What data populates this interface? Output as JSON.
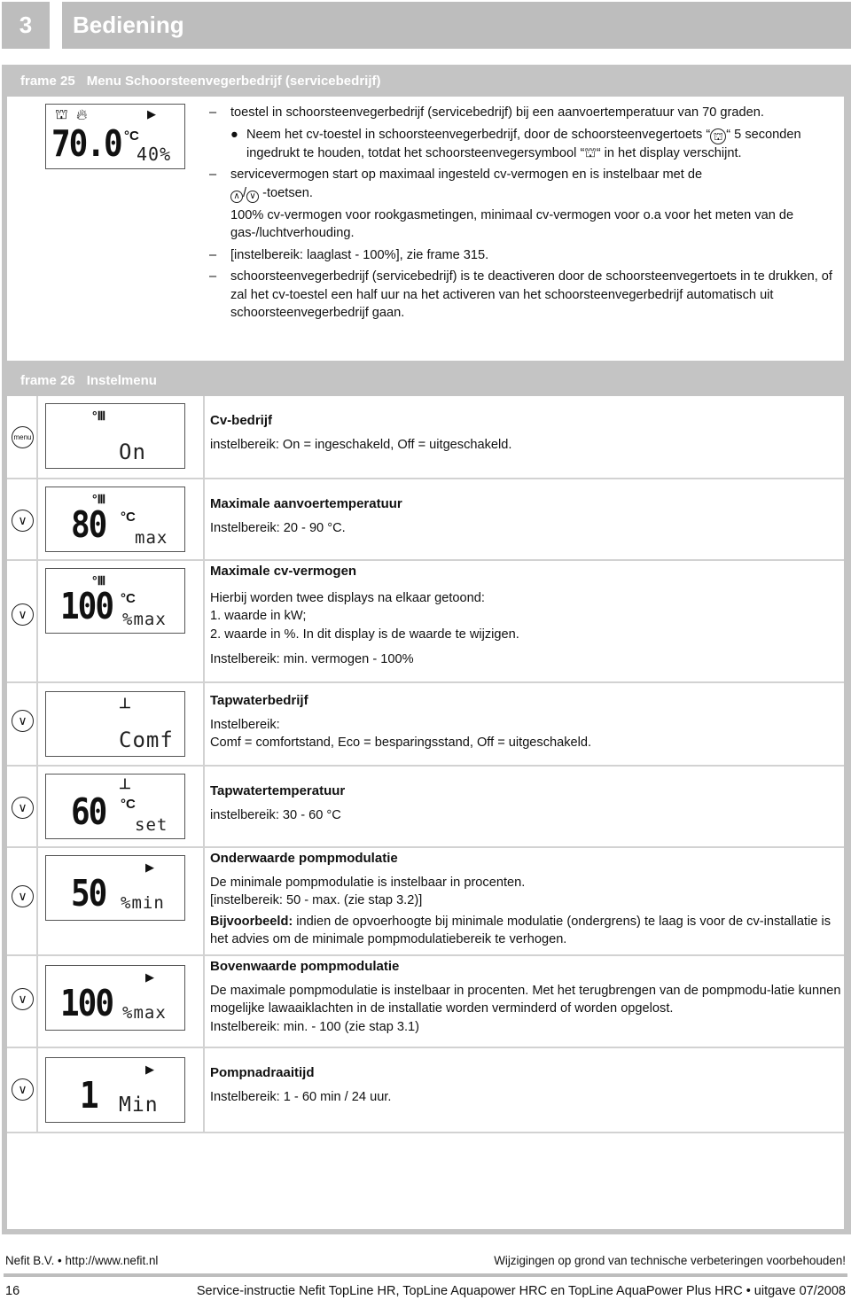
{
  "chapter": {
    "number": "3",
    "title": "Bediening"
  },
  "frame25": {
    "number": "frame 25",
    "title": "Menu Schoorsteenvegerbedrijf (servicebedrijf)",
    "display": {
      "main_value": "70.0",
      "unit": "°C",
      "secondary": "40%",
      "icons": [
        "chimney-sweep-icon",
        "flame-icon",
        "pump-icon"
      ]
    },
    "items": [
      {
        "dash": "–",
        "text": "toestel in schoorsteenvegerbedrijf (servicebedrijf) bij een aanvoertemperatuur van 70 graden."
      },
      {
        "bullet": "●",
        "text_a": "Neem het cv-toestel in schoorsteenvegerbedrijf, door de schoorsteenvegertoets “",
        "text_b": "“ 5 seconden ingedrukt te houden, totdat het schoorsteenvegersymbool “",
        "text_c": "“ in het display verschijnt."
      },
      {
        "dash": "–",
        "text_a": "servicevermogen start op maximaal ingesteld cv-vermogen en is instelbaar met de ",
        "up_key": "∧",
        "slash": "/",
        "down_key": "∨",
        "text_b": " -toetsen."
      },
      {
        "text": "100% cv-vermogen voor rookgasmetingen, minimaal cv-vermogen voor o.a voor het meten van de gas-/luchtverhouding."
      },
      {
        "dash": "–",
        "text": "[instelbereik: laaglast - 100%], zie frame 315."
      },
      {
        "dash": "–",
        "text": "schoorsteenvegerbedrijf (servicebedrijf) is te deactiveren door de schoorsteenvegertoets in te drukken, of zal het cv-toestel een half uur na het activeren van het schoorsteenvegerbedrijf automatisch uit schoorsteenvegerbedrijf gaan."
      }
    ]
  },
  "frame26": {
    "number": "frame 26",
    "title": "Instelmenu",
    "rows": [
      {
        "key": "menu",
        "display": {
          "icon": "radiator-icon",
          "main": "",
          "unit": "",
          "dot": "On"
        },
        "title": "Cv-bedrijf",
        "lines": [
          "instelbereik: On = ingeschakeld, Off = uitgeschakeld."
        ]
      },
      {
        "key": "∨",
        "display": {
          "icon": "radiator-icon",
          "main": "80",
          "unit": "°C",
          "dot": "max"
        },
        "title": "Maximale aanvoertemperatuur",
        "lines": [
          "Instelbereik: 20 - 90 °C."
        ]
      },
      {
        "key": "∨",
        "display": {
          "icon": "radiator-icon",
          "main": "100",
          "unit": "°C",
          "dot": "%max"
        },
        "title": "Maximale cv-vermogen",
        "lines": [
          "Hierbij worden twee displays na elkaar getoond:",
          "1. waarde in kW;",
          "2. waarde in %. In dit display is de waarde te wijzigen.",
          "Instelbereik: min. vermogen - 100%"
        ]
      },
      {
        "key": "∨",
        "display": {
          "icon": "tap-icon",
          "main": "",
          "unit": "",
          "dot": "Comf"
        },
        "title": "Tapwaterbedrijf",
        "lines": [
          "Instelbereik:",
          "Comf = comfortstand, Eco = besparingsstand, Off = uitgeschakeld."
        ]
      },
      {
        "key": "∨",
        "display": {
          "icon": "tap-icon",
          "main": "60",
          "unit": "°C",
          "dot": "set"
        },
        "title": "Tapwatertemperatuur",
        "lines": [
          "instelbereik: 30 - 60 °C"
        ]
      },
      {
        "key": "∨",
        "display": {
          "icon": "pump-icon",
          "main": "50",
          "unit": "",
          "dot": "%min"
        },
        "title": "Onderwaarde pompmodulatie",
        "lines": [
          "De minimale pompmodulatie is instelbaar in procenten.",
          "[instelbereik: 50 - max. (zie stap 3.2)]"
        ],
        "example_label": "Bijvoorbeeld:",
        "example_text": " indien de opvoerhoogte bij minimale modulatie (ondergrens) te laag is voor de cv-installatie is het advies om de minimale pompmodulatiebereik te verhogen."
      },
      {
        "key": "∨",
        "display": {
          "icon": "pump-icon",
          "main": "100",
          "unit": "",
          "dot": "%max"
        },
        "title": "Bovenwaarde pompmodulatie",
        "lines": [
          "De maximale pompmodulatie is instelbaar in procenten. Met het terugbrengen van de pompmodu-latie kunnen mogelijke lawaaiklachten in de installatie worden verminderd of worden opgelost.",
          "Instelbereik: min. - 100 (zie stap 3.1)"
        ]
      },
      {
        "key": "∨",
        "display": {
          "icon": "pump-icon",
          "main": "1",
          "unit": "",
          "dot": "Min"
        },
        "title": "Pompnadraaitijd",
        "lines": [
          "Instelbereik: 1 - 60 min / 24 uur."
        ]
      }
    ]
  },
  "footer": {
    "company": "Nefit B.V. • http://www.nefit.nl",
    "disclaimer": "Wijzigingen op grond van technische verbeteringen voorbehouden!",
    "page": "16",
    "doc_title": "Service-instructie Nefit TopLine HR, TopLine Aquapower HRC en TopLine AquaPower Plus HRC • uitgave 07/2008"
  }
}
